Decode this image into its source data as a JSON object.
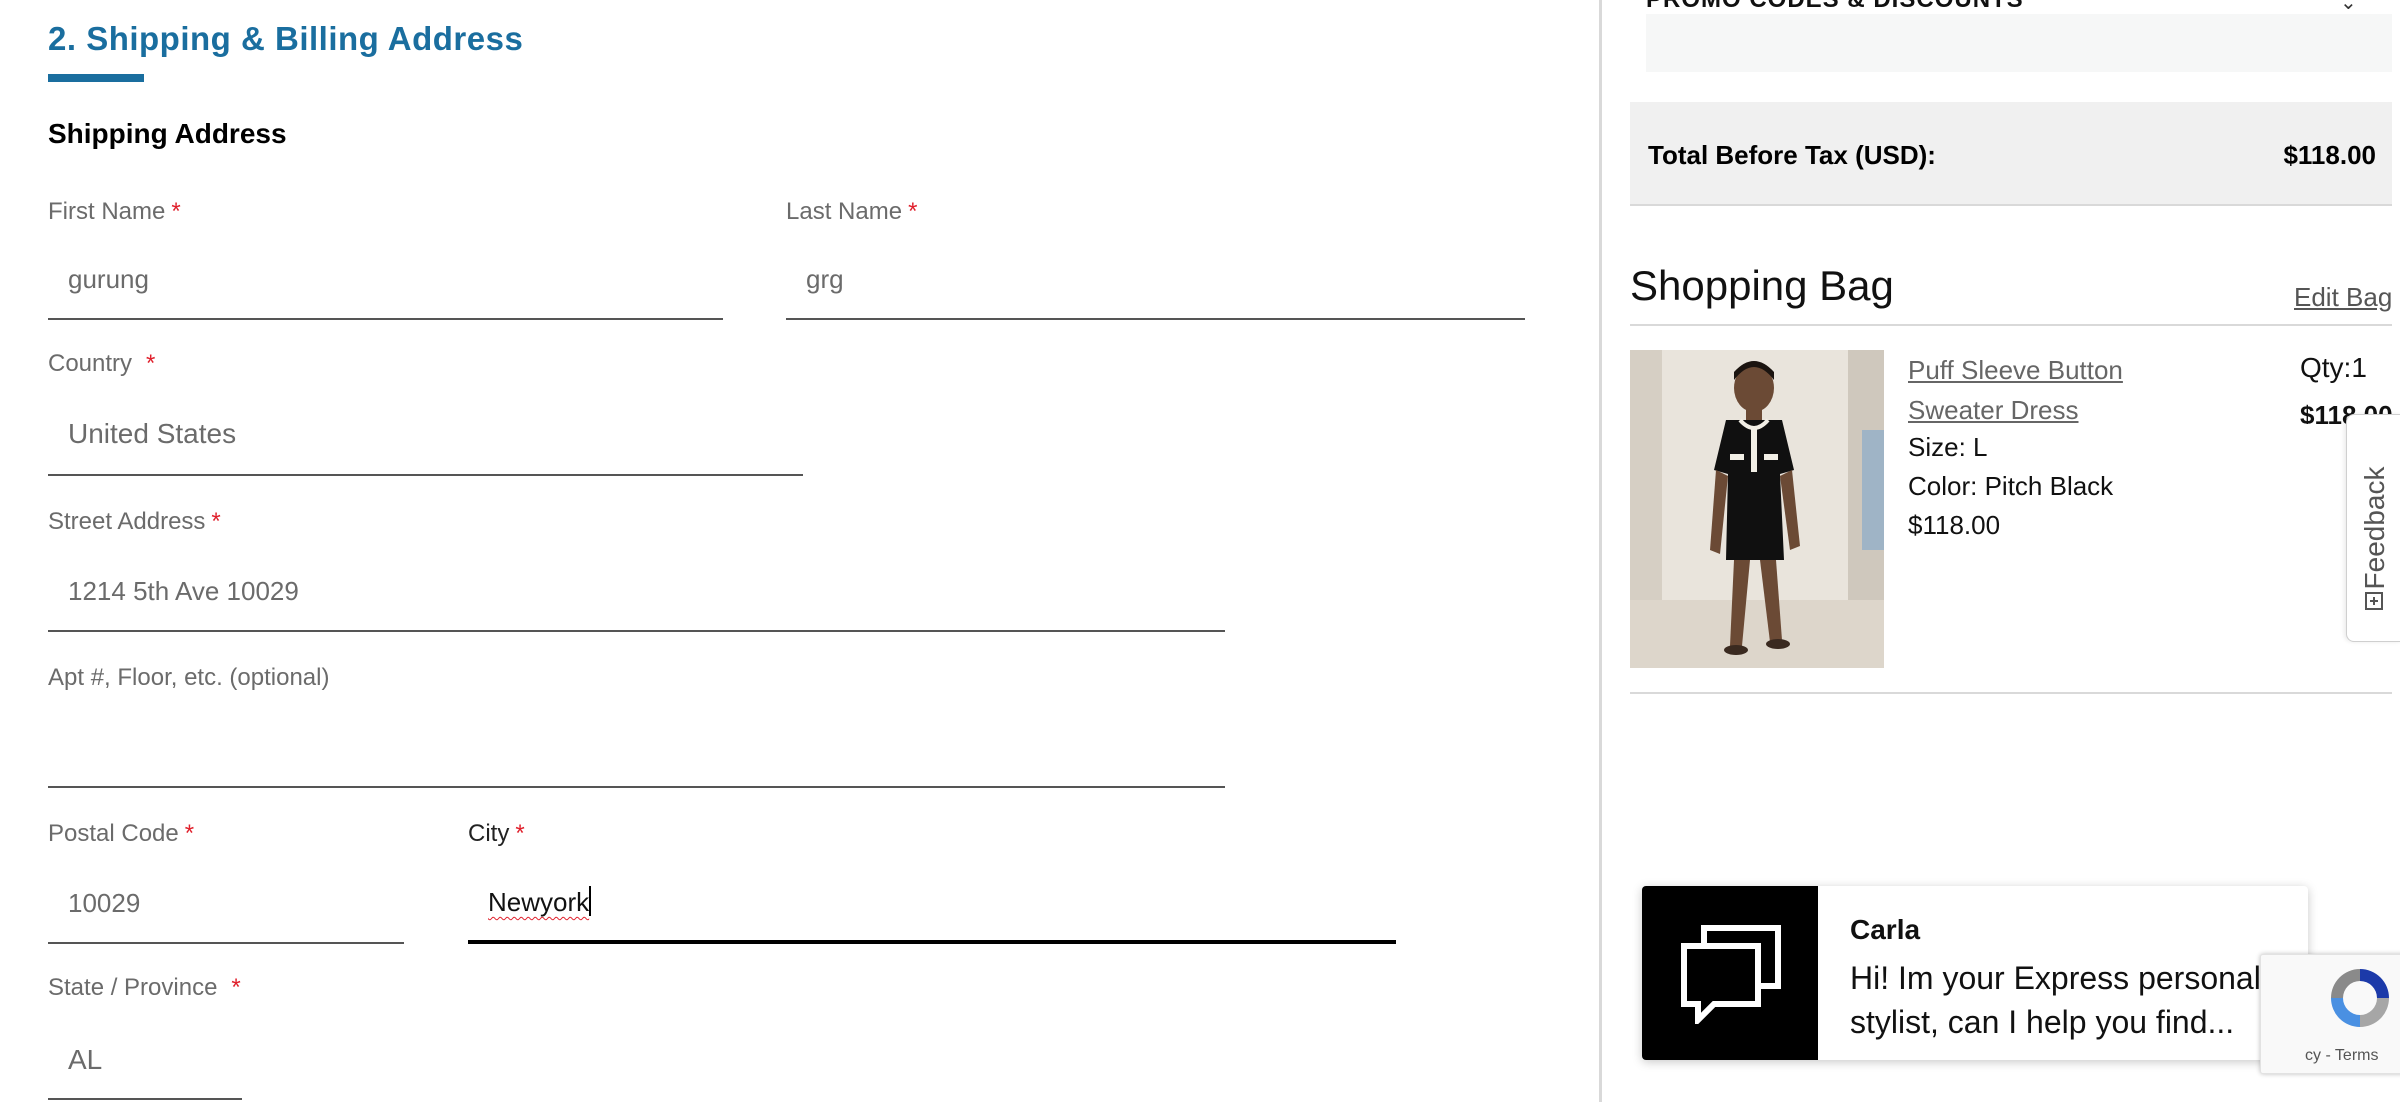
{
  "form": {
    "section_title": "2. Shipping & Billing Address",
    "subsection_title": "Shipping Address",
    "required_marker": "*",
    "fields": {
      "first_name": {
        "label": "First Name",
        "value": "gurung"
      },
      "last_name": {
        "label": "Last Name",
        "value": "grg"
      },
      "country": {
        "label": "Country",
        "value": "United States"
      },
      "street": {
        "label": "Street Address",
        "value": "1214 5th Ave 10029"
      },
      "apt": {
        "label": "Apt #, Floor, etc. (optional)",
        "value": ""
      },
      "postal": {
        "label": "Postal Code",
        "value": "10029"
      },
      "city": {
        "label": "City",
        "value": "Newyork"
      },
      "state": {
        "label": "State / Province",
        "value": "AL"
      }
    }
  },
  "summary": {
    "promo_label": "PROMO CODES & DISCOUNTS",
    "total_label": "Total Before Tax (USD):",
    "total_value": "$118.00",
    "bag_title": "Shopping Bag",
    "edit_bag": "Edit Bag",
    "item": {
      "name": "Puff Sleeve Button Sweater Dress",
      "size": "Size: L",
      "color": "Color: Pitch Black",
      "price": "$118.00",
      "qty": "Qty:1",
      "line_total": "$118.00"
    }
  },
  "feedback": {
    "label": "Feedback"
  },
  "chat": {
    "agent_name": "Carla",
    "message": "Hi! Im your Express personal stylist, can I help you find..."
  },
  "recaptcha": {
    "text": "cy - Terms"
  },
  "icons": {
    "chat": "chat-bubbles-icon",
    "feedback": "feedback-icon",
    "recaptcha": "recaptcha-icon",
    "promo": "chevron-down-icon"
  },
  "colors": {
    "accent": "#1a6e9f",
    "required": "#e0202c"
  }
}
